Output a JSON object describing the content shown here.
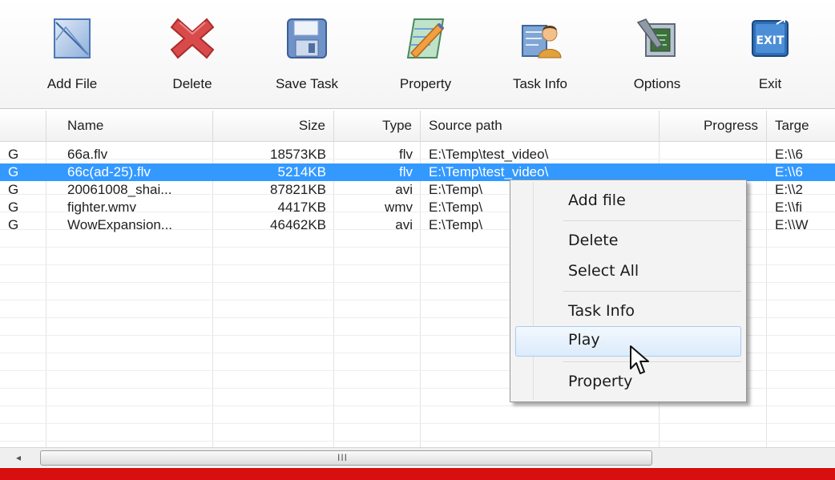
{
  "toolbar": {
    "buttons": [
      {
        "label": "Add File",
        "icon": "add-file-icon"
      },
      {
        "label": "Delete",
        "icon": "delete-x-icon"
      },
      {
        "label": "Save Task",
        "icon": "floppy-disk-icon"
      },
      {
        "label": "Property",
        "icon": "property-edit-icon"
      },
      {
        "label": "Task Info",
        "icon": "task-info-icon"
      },
      {
        "label": "Options",
        "icon": "options-tools-icon"
      },
      {
        "label": "Exit",
        "icon": "exit-icon"
      }
    ],
    "exit_icon_text": "EXIT"
  },
  "table": {
    "columns": [
      "Name",
      "Size",
      "Type",
      "Source path",
      "Progress",
      "Targe"
    ],
    "rows": [
      {
        "flag": "G",
        "name": "66a.flv",
        "size": "18573KB",
        "type": "flv",
        "source": "E:\\Temp\\test_video\\",
        "progress": "",
        "target": "E:\\\\6"
      },
      {
        "flag": "G",
        "name": "66c(ad-25).flv",
        "size": "5214KB",
        "type": "flv",
        "source": "E:\\Temp\\test_video\\",
        "progress": "",
        "target": "E:\\\\6"
      },
      {
        "flag": "G",
        "name": "20061008_shai...",
        "size": "87821KB",
        "type": "avi",
        "source": "E:\\Temp\\",
        "progress": "",
        "target": "E:\\\\2"
      },
      {
        "flag": "G",
        "name": "fighter.wmv",
        "size": "4417KB",
        "type": "wmv",
        "source": "E:\\Temp\\",
        "progress": "",
        "target": "E:\\\\fi"
      },
      {
        "flag": "G",
        "name": "WowExpansion...",
        "size": "46462KB",
        "type": "avi",
        "source": "E:\\Temp\\",
        "progress": "",
        "target": "E:\\\\W"
      }
    ],
    "selected_row": 1
  },
  "scrollbar": {
    "left_arrow": "◂",
    "grip": "III"
  },
  "context_menu": {
    "items": [
      "Add file",
      "Delete",
      "Select All",
      "Task Info",
      "Play",
      "Property"
    ],
    "highlighted": "Play"
  },
  "colors": {
    "selection": "#3399ff",
    "status_bar": "#d80f0f",
    "menu_highlight": "#dcebfb"
  }
}
